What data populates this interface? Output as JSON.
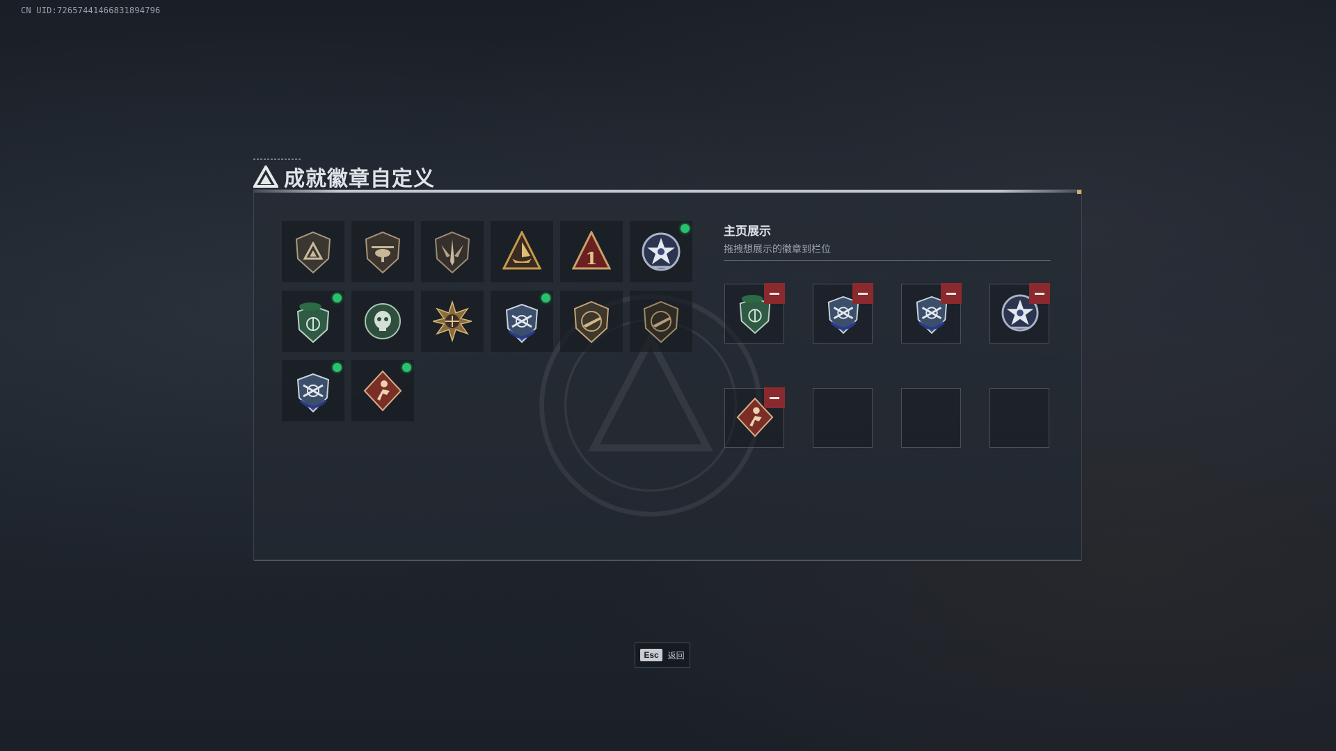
{
  "uid_text": "CN UID:726574414668318947​96",
  "title": "成就徽章自定义",
  "showcase": {
    "title": "主页展示",
    "subtitle": "拖拽想展示的徽章到栏位"
  },
  "footer": {
    "esc_key": "Esc",
    "esc_label": "返回"
  },
  "colors": {
    "accent_new": "#27c26b",
    "remove": "#8a2a2e"
  },
  "badges": [
    {
      "icon": "bronze-triangle-shield-icon",
      "new": false
    },
    {
      "icon": "helicopter-shield-icon",
      "new": false
    },
    {
      "icon": "sword-wing-shield-icon",
      "new": false
    },
    {
      "icon": "gold-ship-triangle-icon",
      "new": false
    },
    {
      "icon": "red-number-one-triangle-icon",
      "new": false
    },
    {
      "icon": "star-round-badge-icon",
      "new": true
    },
    {
      "icon": "green-beret-shield-icon",
      "new": true
    },
    {
      "icon": "green-skull-badge-icon",
      "new": false
    },
    {
      "icon": "gold-sunburst-eagle-icon",
      "new": false
    },
    {
      "icon": "blue-rifle-shield-icon",
      "new": true
    },
    {
      "icon": "bronze-gun-shield-icon",
      "new": false
    },
    {
      "icon": "dark-gun-shield-icon",
      "new": false
    },
    {
      "icon": "blue-rifle-shield-icon",
      "new": true
    },
    {
      "icon": "red-soldier-diamond-icon",
      "new": true
    }
  ],
  "slots": [
    {
      "icon": "green-beret-shield-icon",
      "filled": true
    },
    {
      "icon": "blue-rifle-shield-icon",
      "filled": true
    },
    {
      "icon": "blue-rifle-shield-icon",
      "filled": true
    },
    {
      "icon": "star-round-badge-icon",
      "filled": true
    },
    {
      "icon": "red-soldier-diamond-icon",
      "filled": true
    },
    {
      "icon": "",
      "filled": false
    },
    {
      "icon": "",
      "filled": false
    },
    {
      "icon": "",
      "filled": false
    }
  ]
}
